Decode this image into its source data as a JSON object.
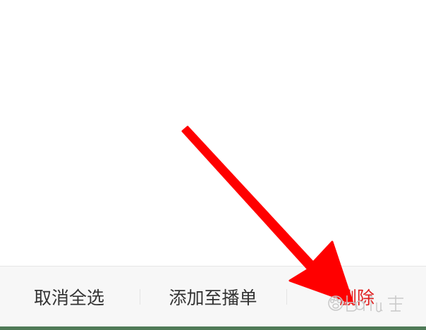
{
  "bottom_bar": {
    "deselect_all": "取消全选",
    "add_to_playlist": "添加至播单",
    "delete": "删除"
  },
  "colors": {
    "bar_background": "#f7f7f7",
    "action_text": "#333333",
    "delete_text": "#e02020",
    "annotation_arrow": "#ff0000",
    "bottom_strip": "#4f7a57"
  },
  "annotation": {
    "icon": "red-arrow-icon"
  },
  "watermark": {
    "icon": "baidu-paw-icon"
  }
}
